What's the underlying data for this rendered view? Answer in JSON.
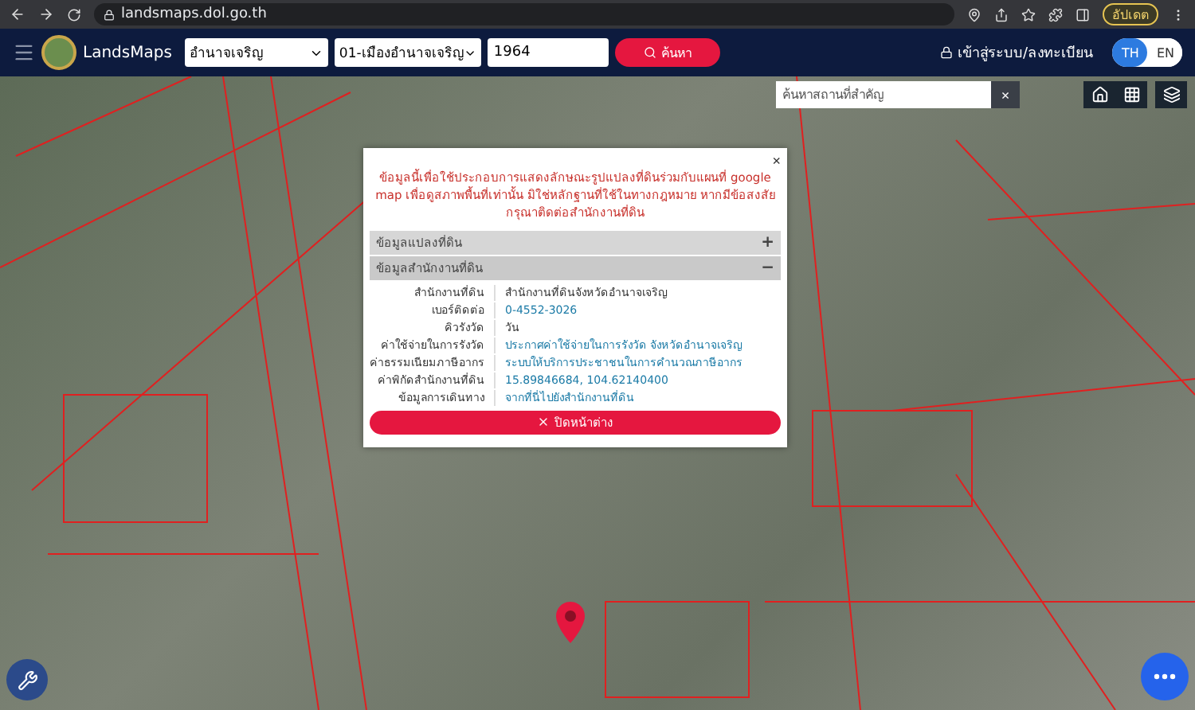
{
  "browser": {
    "url": "landsmaps.dol.go.th",
    "update_label": "อัปเดต"
  },
  "header": {
    "logo_text": "LandsMaps",
    "province": "อำนาจเจริญ",
    "district": "01-เมืองอำนาจเจริญ",
    "parcel_number": "1964",
    "search_button": "ค้นหา",
    "login": "เข้าสู่ระบบ/ลงทะเบียน",
    "languages": [
      {
        "label": "TH",
        "selected": true
      },
      {
        "label": "EN",
        "selected": false
      }
    ]
  },
  "map_search": {
    "placeholder": "ค้นหาสถานที่สำคัญ",
    "clear": "×"
  },
  "popup": {
    "close": "×",
    "notice": "ข้อมูลนี้เพื่อใช้ประกอบการแสดงลักษณะรูปแปลงที่ดินร่วมกับแผนที่ google map เพื่อดูสภาพพื้นที่เท่านั้น มิใช่หลักฐานที่ใช้ในทางกฎหมาย หากมีข้อสงสัย กรุณาติดต่อสำนักงานที่ดิน",
    "sections": [
      {
        "title": "ข้อมูลแปลงที่ดิน",
        "expanded": false,
        "sign": "+"
      },
      {
        "title": "ข้อมูลสำนักงานที่ดิน",
        "expanded": true,
        "sign": "−"
      }
    ],
    "rows": [
      {
        "label": "สำนักงานที่ดิน",
        "value": "สำนักงานที่ดินจังหวัดอำนาจเจริญ",
        "kind": "text"
      },
      {
        "label": "เบอร์ติดต่อ",
        "value": "0-4552-3026",
        "kind": "link"
      },
      {
        "label": "คิวรังวัด",
        "value": "วัน",
        "kind": "text"
      },
      {
        "label": "ค่าใช้จ่ายในการรังวัด",
        "value": "ประกาศค่าใช้จ่ายในการรังวัด จังหวัดอำนาจเจริญ",
        "kind": "link"
      },
      {
        "label": "ค่าธรรมเนียมภาษีอากร",
        "value": "ระบบให้บริการประชาชนในการคำนวณภาษีอากร",
        "kind": "link"
      },
      {
        "label": "ค่าพิกัดสำนักงานที่ดิน",
        "value": "15.89846684, 104.62140400",
        "kind": "link"
      },
      {
        "label": "ข้อมูลการเดินทาง",
        "value": "จากที่นี่ไปยังสำนักงานที่ดิน",
        "kind": "link"
      }
    ],
    "close_button": "ปิดหน้าต่าง"
  }
}
